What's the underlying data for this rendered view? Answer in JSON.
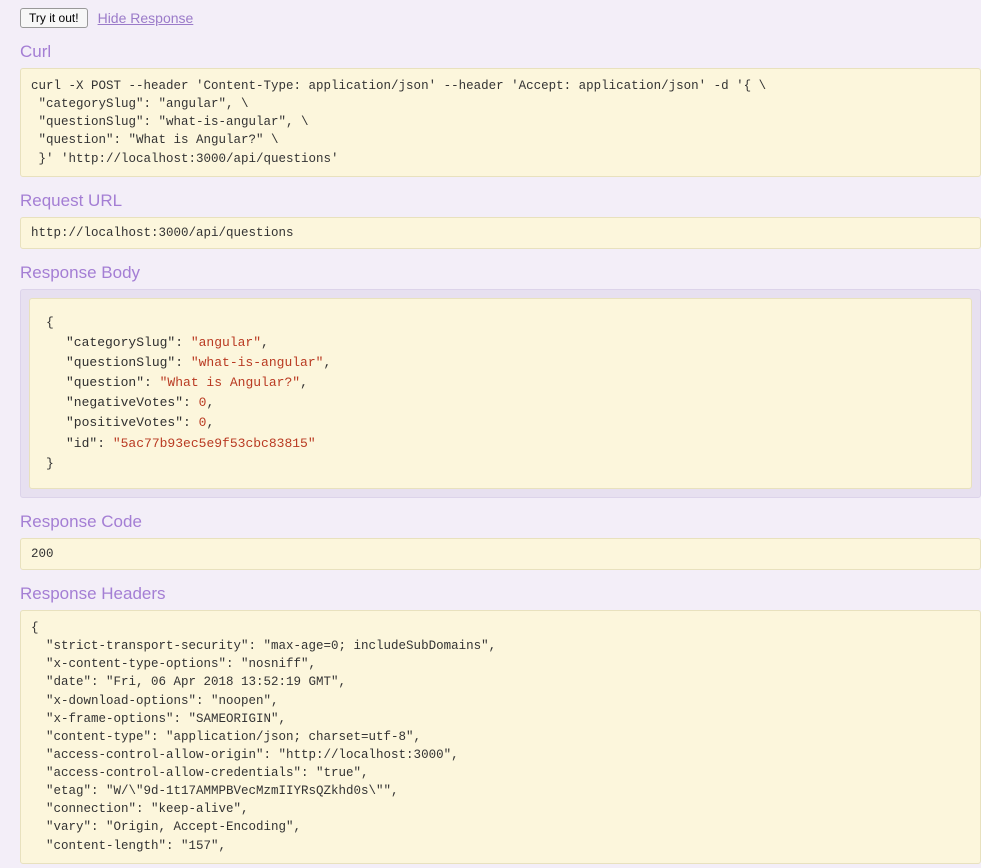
{
  "topbar": {
    "try_label": "Try it out!",
    "hide_label": "Hide Response"
  },
  "curl": {
    "title": "Curl",
    "content": "curl -X POST --header 'Content-Type: application/json' --header 'Accept: application/json' -d '{ \\ \n \"categorySlug\": \"angular\", \\ \n \"questionSlug\": \"what-is-angular\", \\ \n \"question\": \"What is Angular?\" \\ \n }' 'http://localhost:3000/api/questions'"
  },
  "request_url": {
    "title": "Request URL",
    "content": "http://localhost:3000/api/questions"
  },
  "response_body": {
    "title": "Response Body",
    "lines": [
      {
        "k": "categorySlug",
        "t": "str",
        "v": "angular",
        "comma": true
      },
      {
        "k": "questionSlug",
        "t": "str",
        "v": "what-is-angular",
        "comma": true
      },
      {
        "k": "question",
        "t": "str",
        "v": "What is Angular?",
        "comma": true
      },
      {
        "k": "negativeVotes",
        "t": "num",
        "v": "0",
        "comma": true
      },
      {
        "k": "positiveVotes",
        "t": "num",
        "v": "0",
        "comma": true
      },
      {
        "k": "id",
        "t": "str",
        "v": "5ac77b93ec5e9f53cbc83815",
        "comma": false
      }
    ]
  },
  "response_code": {
    "title": "Response Code",
    "content": "200"
  },
  "response_headers": {
    "title": "Response Headers",
    "content": "{\n  \"strict-transport-security\": \"max-age=0; includeSubDomains\",\n  \"x-content-type-options\": \"nosniff\",\n  \"date\": \"Fri, 06 Apr 2018 13:52:19 GMT\",\n  \"x-download-options\": \"noopen\",\n  \"x-frame-options\": \"SAMEORIGIN\",\n  \"content-type\": \"application/json; charset=utf-8\",\n  \"access-control-allow-origin\": \"http://localhost:3000\",\n  \"access-control-allow-credentials\": \"true\",\n  \"etag\": \"W/\\\"9d-1t17AMMPBVecMzmIIYRsQZkhd0s\\\"\",\n  \"connection\": \"keep-alive\",\n  \"vary\": \"Origin, Accept-Encoding\",\n  \"content-length\": \"157\","
  }
}
